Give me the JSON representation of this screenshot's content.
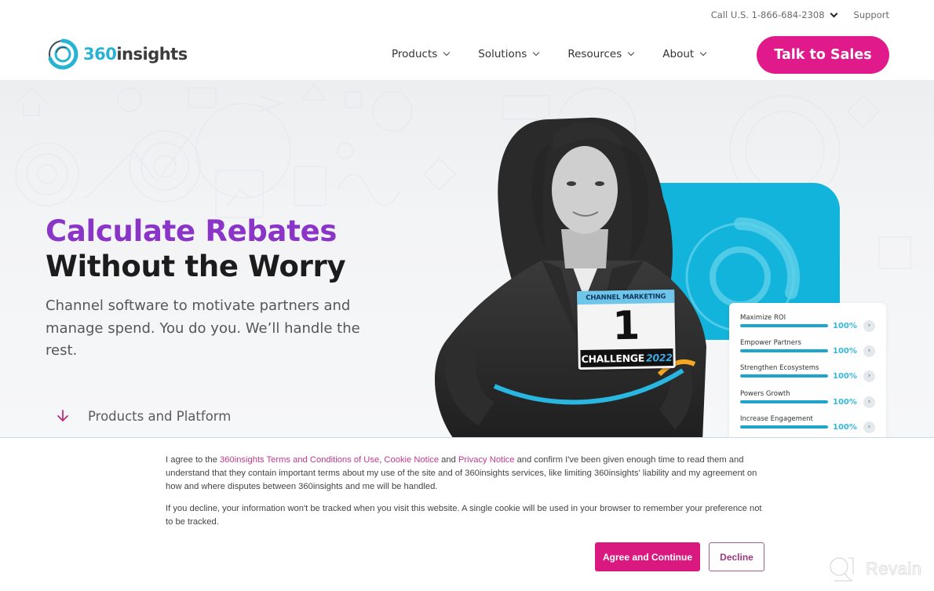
{
  "header": {
    "utility": {
      "phone_label": "Call U.S. 1-866-684-2308",
      "support_label": "Support"
    },
    "logo": {
      "number": "360",
      "word": "insights"
    },
    "nav": [
      {
        "label": "Products"
      },
      {
        "label": "Solutions"
      },
      {
        "label": "Resources"
      },
      {
        "label": "About"
      }
    ],
    "cta_label": "Talk to Sales"
  },
  "hero": {
    "title_line1": "Calculate Rebates",
    "title_line2": "Without the Worry",
    "subtitle": "Channel software to motivate partners and manage spend. You do you. We’ll handle the rest.",
    "scroll_link": "Products and Platform",
    "bib": {
      "top": "CHANNEL MARKETING",
      "number": "1",
      "bottom": "CHALLENGE",
      "year": "2022"
    },
    "stats": [
      {
        "label": "Maximize ROI",
        "value": "100%",
        "progress": 100
      },
      {
        "label": "Empower Partners",
        "value": "100%",
        "progress": 100
      },
      {
        "label": "Strengthen Ecosystems",
        "value": "100%",
        "progress": 100
      },
      {
        "label": "Powers Growth",
        "value": "100%",
        "progress": 100
      },
      {
        "label": "Increase Engagement",
        "value": "100%",
        "progress": 100
      }
    ]
  },
  "cookie_banner": {
    "p1_before": "I agree to the ",
    "link_terms": "360insights Terms and Conditions of Use",
    "p1_sep1": ", ",
    "link_cookie": "Cookie Notice",
    "p1_sep2": " and ",
    "link_privacy": "Privacy Notice",
    "p1_after": " and confirm I've been given enough time to read them and understand that they contain important terms about my use of the site and of 360insights services, like limiting 360insights' liability and my agreement on how and where disputes between 360insights and me will be handled.",
    "p2": "If you decline, your information won't be tracked when you visit this website. A single cookie will be used in your browser to remember your preference not to be tracked.",
    "agree_label": "Agree and Continue",
    "decline_label": "Decline"
  },
  "watermark": {
    "label": "Revain"
  },
  "colors": {
    "brand_magenta": "#e01a8a",
    "brand_purple": "#8a35c8",
    "brand_cyan": "#12b4dc",
    "link_pink": "#c2388e"
  }
}
